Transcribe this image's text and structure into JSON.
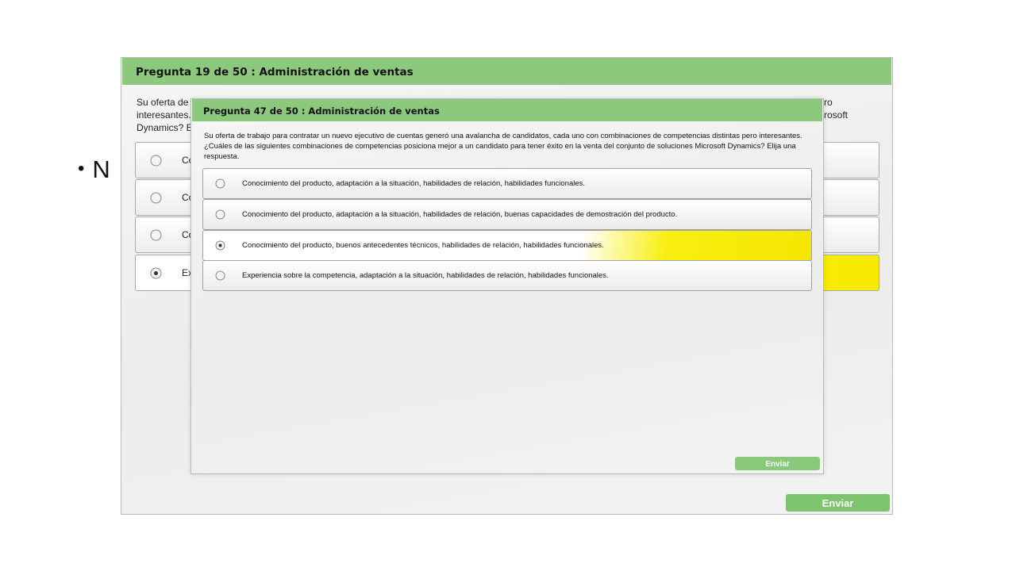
{
  "slide": {
    "bullet_text": "N"
  },
  "back_dialog": {
    "title": "Pregunta 19 de 50 : Administración de ventas",
    "question_fragment_left": "Su oferta de\ninteresantes.\nDynamics? E",
    "question_fragment_right": "ro\nrosoft",
    "options": [
      {
        "label": "Co",
        "selected": false
      },
      {
        "label": "Co",
        "selected": false
      },
      {
        "label": "Co",
        "selected": false
      },
      {
        "label": "Ex",
        "selected": true
      }
    ],
    "submit_label": "Enviar"
  },
  "front_dialog": {
    "title": "Pregunta 47 de 50 : Administración de ventas",
    "question": "Su oferta de trabajo para contratar un nuevo ejecutivo de cuentas generó una avalancha de candidatos, cada uno con combinaciones de competencias distintas pero interesantes. ¿Cuáles de las siguientes combinaciones de competencias posiciona mejor a un candidato para tener éxito en la venta del conjunto de soluciones Microsoft Dynamics? Elija una respuesta.",
    "options": [
      {
        "label": "Conocimiento del producto, adaptación a la situación, habilidades de relación, habilidades funcionales.",
        "selected": false
      },
      {
        "label": "Conocimiento del producto, adaptación a la situación, habilidades de relación, buenas capacidades de demostración del producto.",
        "selected": false
      },
      {
        "label": "Conocimiento del producto, buenos antecedentes técnicos, habilidades de relación, habilidades funcionales.",
        "selected": true
      },
      {
        "label": "Experiencia sobre la competencia, adaptación a la situación, habilidades de relación, habilidades funcionales.",
        "selected": false
      }
    ],
    "submit_label": "Enviar"
  },
  "colors": {
    "header_green": "#8dc97d",
    "button_green": "#7dc46c",
    "selected_yellow": "#f8ea00"
  }
}
